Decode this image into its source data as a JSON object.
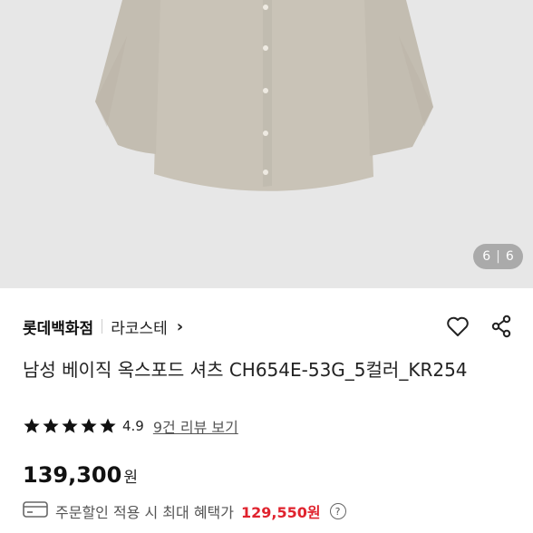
{
  "gallery": {
    "current": "6",
    "separator": "|",
    "total": "6"
  },
  "store": {
    "name": "롯데백화점",
    "brand": "라코스테",
    "brand_chevron": "›"
  },
  "product": {
    "title": "남성 베이직 옥스포드 셔츠 CH654E-53G_5컬러_KR254",
    "rating": "4.9",
    "rating_value": 4.9,
    "review_link": "9건 리뷰 보기",
    "price": "139,300",
    "currency": "원"
  },
  "benefit": {
    "label": "주문할인 적용 시 최대 혜택가",
    "price": "129,550원",
    "help": "?"
  },
  "colors": {
    "accent_red": "#e0232e",
    "shirt": "#c9c3b7",
    "background": "#e7e7e7"
  }
}
